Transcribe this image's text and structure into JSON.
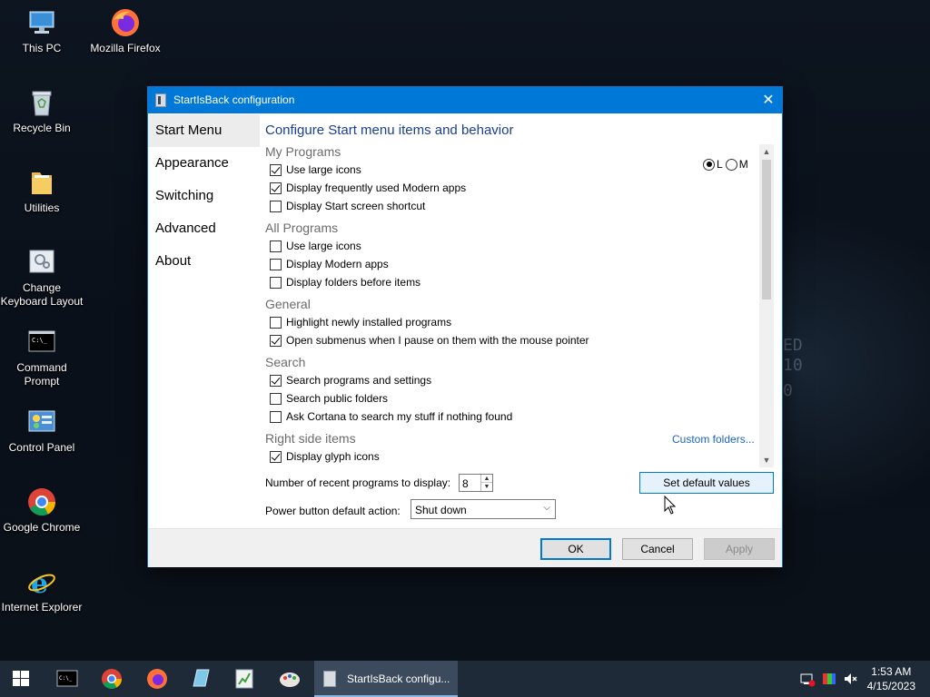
{
  "desktop": {
    "background_text": [
      "ED",
      "10",
      "0"
    ],
    "icons": [
      {
        "label": "This PC"
      },
      {
        "label": "Mozilla Firefox"
      },
      {
        "label": "Recycle Bin"
      },
      {
        "label": "Utilities"
      },
      {
        "label": "Change Keyboard Layout"
      },
      {
        "label": "Command Prompt"
      },
      {
        "label": "Control Panel"
      },
      {
        "label": "Google Chrome"
      },
      {
        "label": "Internet Explorer"
      }
    ]
  },
  "window": {
    "title": "StartIsBack configuration",
    "close_glyph": "✕",
    "nav": [
      {
        "label": "Start Menu",
        "active": true
      },
      {
        "label": "Appearance"
      },
      {
        "label": "Switching"
      },
      {
        "label": "Advanced"
      },
      {
        "label": "About"
      }
    ],
    "heading": "Configure Start menu items and behavior",
    "sections": {
      "my_programs": "My Programs",
      "all_programs": "All Programs",
      "general": "General",
      "search": "Search",
      "right_side_items": "Right side items"
    },
    "options": {
      "mp_large_icons": {
        "label": "Use large icons",
        "checked": true
      },
      "mp_modern_apps": {
        "label": "Display frequently used Modern apps",
        "checked": true
      },
      "mp_start_screen": {
        "label": "Display Start screen shortcut",
        "checked": false
      },
      "ap_large_icons": {
        "label": "Use large icons",
        "checked": false
      },
      "ap_modern_apps": {
        "label": "Display Modern apps",
        "checked": false
      },
      "ap_folders_first": {
        "label": "Display folders before items",
        "checked": false
      },
      "gen_highlight": {
        "label": "Highlight newly installed programs",
        "checked": false
      },
      "gen_submenus": {
        "label": "Open submenus when I pause on them with the mouse pointer",
        "checked": true
      },
      "search_programs": {
        "label": "Search programs and settings",
        "checked": true
      },
      "search_public": {
        "label": "Search public folders",
        "checked": false
      },
      "search_cortana": {
        "label": "Ask Cortana to search my stuff if nothing found",
        "checked": false
      },
      "rs_glyph_icons": {
        "label": "Display glyph icons",
        "checked": true
      }
    },
    "icon_size_radio": {
      "options": [
        "L",
        "M"
      ],
      "selected": "L"
    },
    "custom_folders_link": "Custom folders...",
    "recent_programs_label": "Number of recent programs to display:",
    "recent_programs_value": "8",
    "power_button_label": "Power button default action:",
    "power_button_value": "Shut down",
    "set_default_label": "Set default values",
    "buttons": {
      "ok": "OK",
      "cancel": "Cancel",
      "apply": "Apply"
    }
  },
  "taskbar": {
    "task_label": "StartIsBack configu...",
    "clock_time": "1:53 AM",
    "clock_date": "4/15/2023"
  },
  "colors": {
    "accent": "#0078d7",
    "heading": "#1a3f8f",
    "link": "#1a63c4"
  }
}
